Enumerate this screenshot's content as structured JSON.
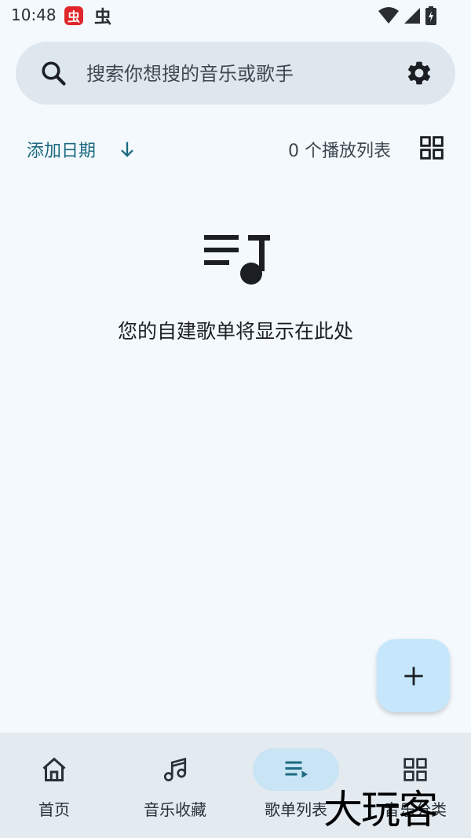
{
  "status_bar": {
    "time": "10:48",
    "app_icon_glyph": "虫",
    "app_icon2_glyph": "虫"
  },
  "search": {
    "placeholder": "搜索你想搜的音乐或歌手"
  },
  "sort": {
    "label": "添加日期",
    "direction_icon": "arrow-down-icon"
  },
  "playlist_count": "0 个播放列表",
  "empty_state": {
    "icon": "playlist-music-icon",
    "text": "您的自建歌单将显示在此处"
  },
  "fab": {
    "icon": "plus-icon"
  },
  "bottom_nav": {
    "items": [
      {
        "label": "首页",
        "icon": "home-icon",
        "active": false
      },
      {
        "label": "音乐收藏",
        "icon": "music-note-icon",
        "active": false
      },
      {
        "label": "歌单列表",
        "icon": "playlist-icon",
        "active": true
      },
      {
        "label": "音乐分类",
        "icon": "grid-icon",
        "active": false
      }
    ]
  },
  "watermark": "大玩客",
  "colors": {
    "accent": "#1c6a80",
    "background": "#f3f9fd",
    "search_bg": "#dfe7ee",
    "nav_bg": "#e3eaf0",
    "nav_active_pill": "#c9e4f4",
    "fab_bg": "#c6e7fb",
    "status_icon_red": "#e0262a"
  }
}
